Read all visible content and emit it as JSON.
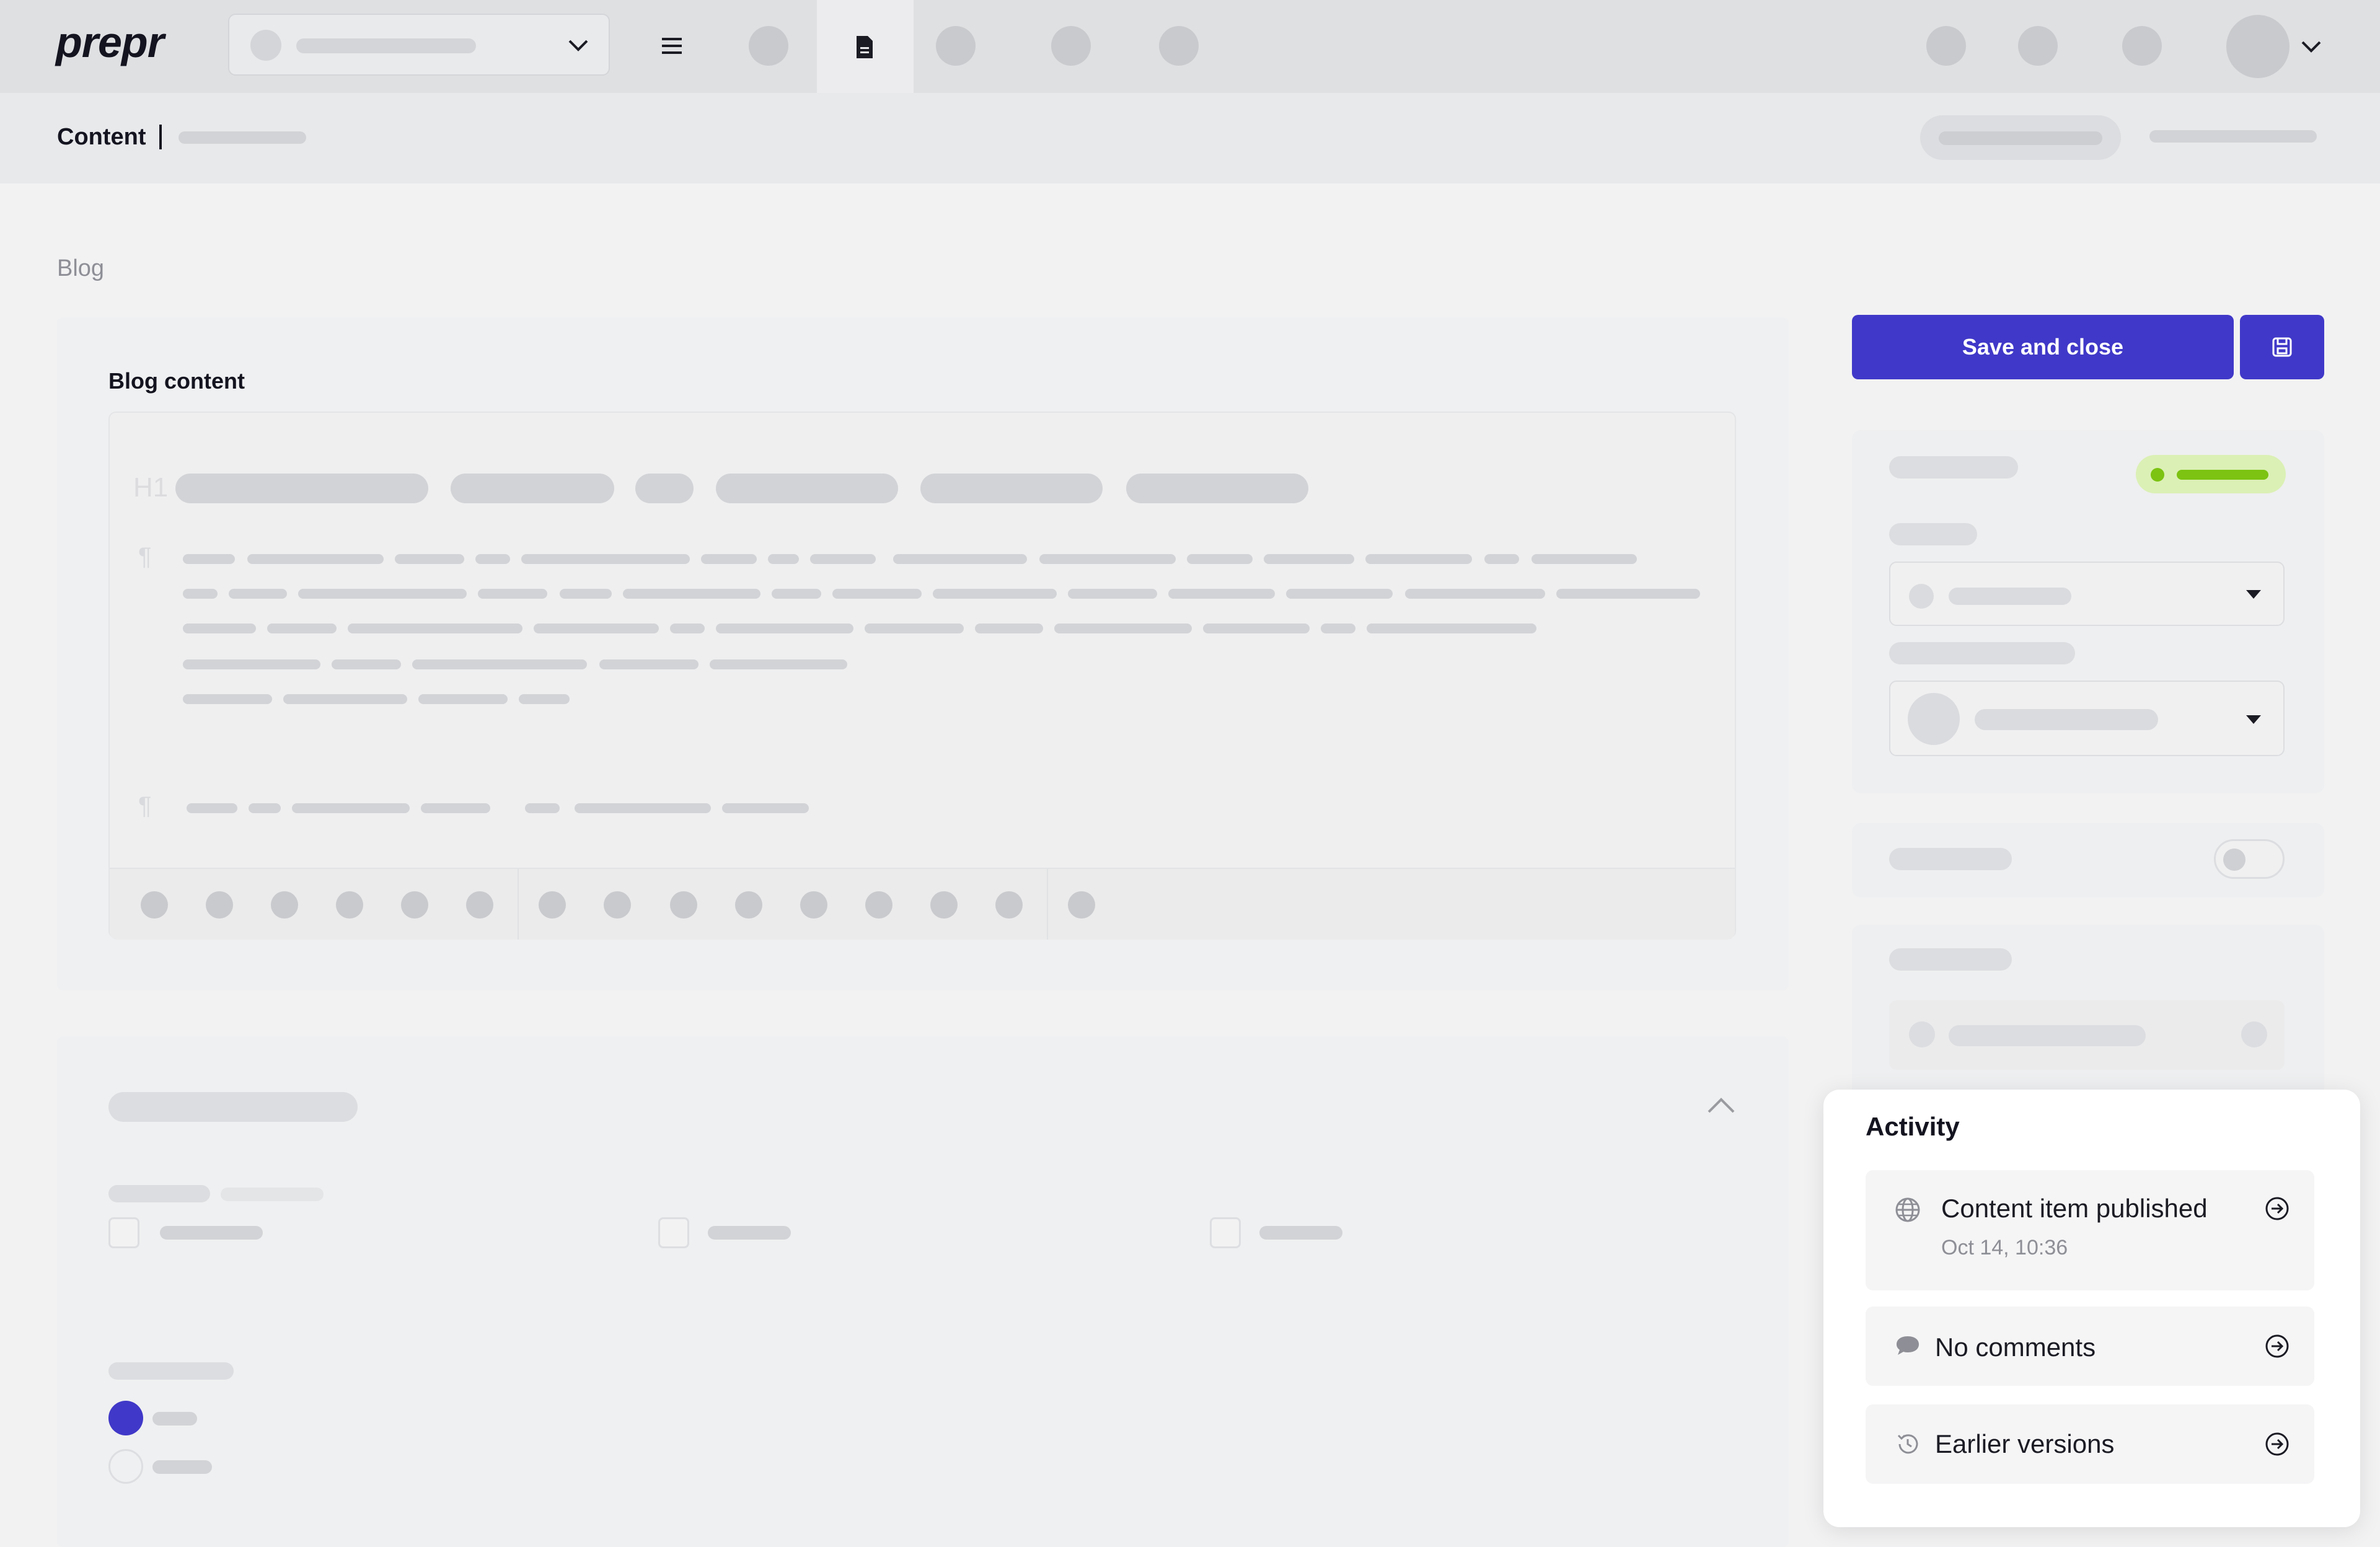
{
  "app": {
    "logo": "prepr"
  },
  "header": {
    "breadcrumb": "Content"
  },
  "main": {
    "section_label": "Blog",
    "editor_label": "Blog content",
    "heading_marker": "H1"
  },
  "actions": {
    "save_and_close": "Save and close"
  },
  "activity": {
    "title": "Activity",
    "items": [
      {
        "label": "Content item published",
        "sub": "Oct 14, 10:36",
        "icon": "globe-icon"
      },
      {
        "label": "No comments",
        "icon": "comment-icon"
      },
      {
        "label": "Earlier versions",
        "icon": "history-icon"
      }
    ]
  },
  "colors": {
    "primary": "#4038c8",
    "status_green": "#7cc312",
    "status_green_bg": "#dbf0b5",
    "radio_selected": "#4038c8"
  }
}
